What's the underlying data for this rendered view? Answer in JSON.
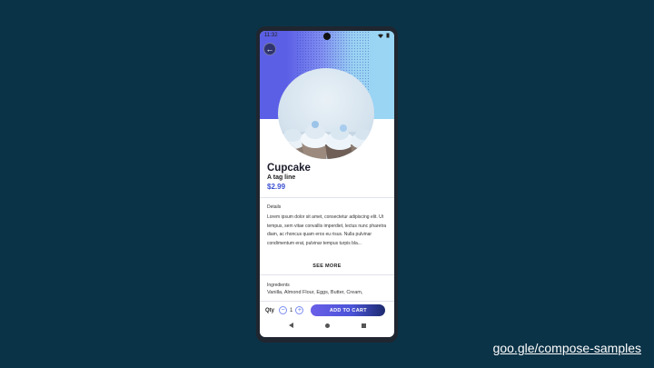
{
  "status_bar": {
    "time": "11:32"
  },
  "product": {
    "name": "Cupcake",
    "tagline": "A tag line",
    "price": "$2.99",
    "details_label": "Details",
    "details_text": "Lorem ipsum dolor sit amet, consectetur adipiscing elit. Ut tempus, sem vitae convallis imperdiet, lectus nunc pharetra diam, ac rhoncus quam eros eu risus. Nulla pulvinar condimentum erat, pulvinar tempus turpis bla...",
    "see_more": "SEE MORE",
    "ingredients_label": "Ingredients",
    "ingredients_text": "Vanilla, Almond Flour, Eggs, Butter, Cream,"
  },
  "cart": {
    "qty_label": "Qty",
    "quantity": "1",
    "minus": "−",
    "plus": "+",
    "add_label": "ADD TO CART"
  },
  "footer": {
    "link": "goo.gle/compose-samples"
  },
  "colors": {
    "background": "#0b3347",
    "accent": "#5b5fe6",
    "price": "#3b4fd1"
  }
}
